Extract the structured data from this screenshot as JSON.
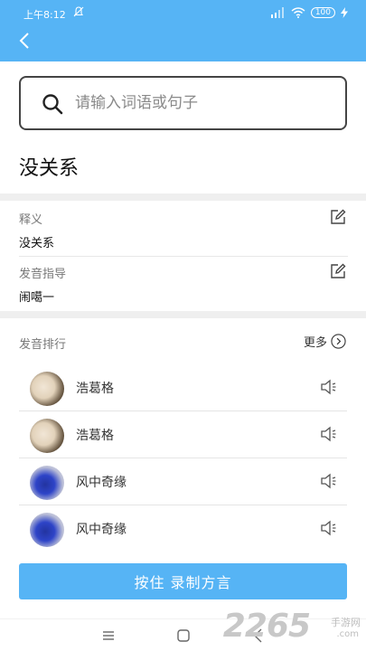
{
  "status_bar": {
    "time": "上午8:12",
    "battery": "100"
  },
  "search": {
    "placeholder": "请输入词语或句子"
  },
  "word": {
    "title": "没关系"
  },
  "definition": {
    "label": "释义",
    "value": "没关系"
  },
  "pronunciation_guide": {
    "label": "发音指导",
    "value": "闹噶一"
  },
  "ranking": {
    "title": "发音排行",
    "more_label": "更多",
    "items": [
      {
        "name": "浩葛格"
      },
      {
        "name": "浩葛格"
      },
      {
        "name": "风中奇缘"
      },
      {
        "name": "风中奇缘"
      }
    ]
  },
  "record_button": {
    "label": "按住 录制方言"
  },
  "watermark": {
    "number": "2265",
    "site": "手游网",
    "domain": ".com"
  },
  "colors": {
    "accent": "#56b4f5"
  }
}
